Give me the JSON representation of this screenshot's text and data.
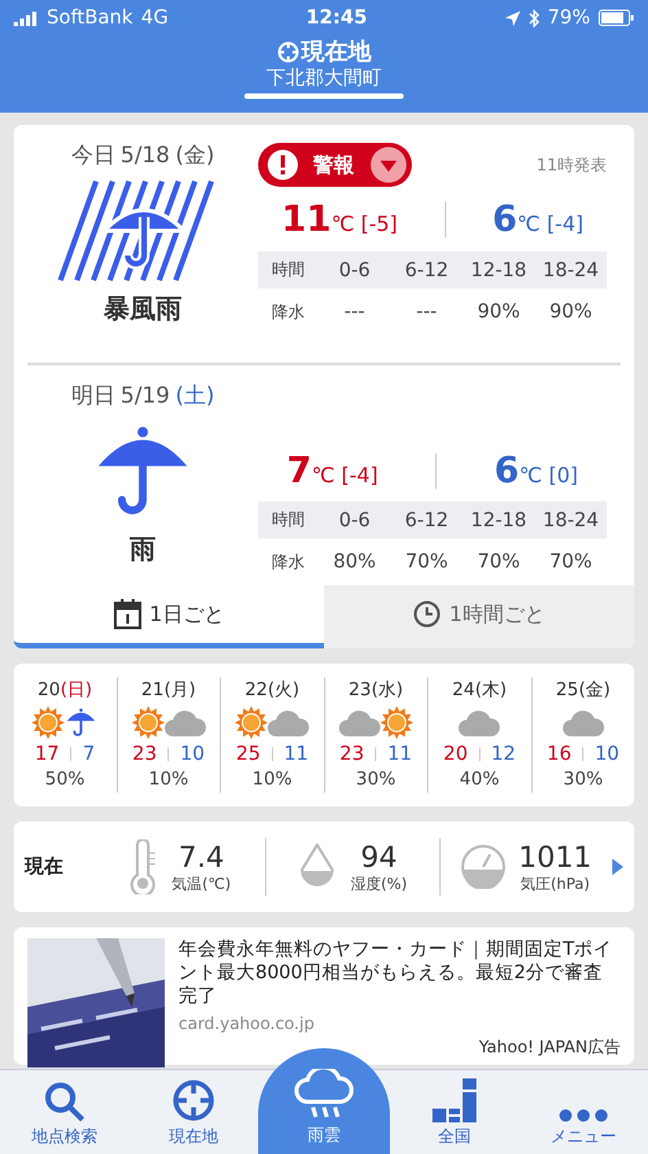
{
  "status": {
    "carrier": "SoftBank",
    "network": "4G",
    "time": "12:45",
    "battery": "79%"
  },
  "header": {
    "title": "現在地",
    "subtitle": "下北郡大間町"
  },
  "forecasts": [
    {
      "label": "今日",
      "date": "5/18",
      "weekday": "(金)",
      "saturday": false,
      "kind": "storm",
      "weather": "暴風雨",
      "warning": {
        "label": "警報"
      },
      "issued": "11時発表",
      "high": {
        "value": "11",
        "unit": "℃",
        "diff": "[-5]"
      },
      "low": {
        "value": "6",
        "unit": "℃",
        "diff": "[-4]"
      },
      "table": {
        "head": "時間",
        "columns": [
          "0-6",
          "6-12",
          "12-18",
          "18-24"
        ],
        "row": "降水",
        "values": [
          "---",
          "---",
          "90%",
          "90%"
        ]
      }
    },
    {
      "label": "明日",
      "date": "5/19",
      "weekday": "(土)",
      "saturday": true,
      "kind": "rain",
      "weather": "雨",
      "high": {
        "value": "7",
        "unit": "℃",
        "diff": "[-4]"
      },
      "low": {
        "value": "6",
        "unit": "℃",
        "diff": "[0]"
      },
      "table": {
        "head": "時間",
        "columns": [
          "0-6",
          "6-12",
          "12-18",
          "18-24"
        ],
        "row": "降水",
        "values": [
          "80%",
          "70%",
          "70%",
          "70%"
        ]
      }
    }
  ],
  "tabs": [
    {
      "label": "1日ごと",
      "kind": "calendar",
      "selected": true
    },
    {
      "label": "1時間ごと",
      "kind": "clock",
      "selected": false
    }
  ],
  "week": [
    {
      "day": "20",
      "weekday": "(日)",
      "holiday": true,
      "icons": [
        {
          "kind": "sun"
        },
        {
          "kind": "umbrella"
        }
      ],
      "high": "17",
      "low": "7",
      "pop": "50%"
    },
    {
      "day": "21",
      "weekday": "(月)",
      "holiday": false,
      "icons": [
        {
          "kind": "sun"
        },
        {
          "kind": "cloud"
        }
      ],
      "high": "23",
      "low": "10",
      "pop": "10%"
    },
    {
      "day": "22",
      "weekday": "(火)",
      "holiday": false,
      "icons": [
        {
          "kind": "sun"
        },
        {
          "kind": "cloud"
        }
      ],
      "high": "25",
      "low": "11",
      "pop": "10%"
    },
    {
      "day": "23",
      "weekday": "(水)",
      "holiday": false,
      "icons": [
        {
          "kind": "cloud"
        },
        {
          "kind": "sun"
        }
      ],
      "high": "23",
      "low": "11",
      "pop": "30%"
    },
    {
      "day": "24",
      "weekday": "(木)",
      "holiday": false,
      "icons": [
        {
          "kind": "cloud"
        }
      ],
      "high": "20",
      "low": "12",
      "pop": "40%"
    },
    {
      "day": "25",
      "weekday": "(金)",
      "holiday": false,
      "icons": [
        {
          "kind": "cloud"
        }
      ],
      "high": "16",
      "low": "10",
      "pop": "30%"
    }
  ],
  "current": {
    "label": "現在",
    "items": [
      {
        "kind": "thermometer",
        "value": "7.4",
        "label": "気温(℃)"
      },
      {
        "kind": "drop",
        "value": "94",
        "label": "湿度(%)"
      },
      {
        "kind": "gauge",
        "value": "1011",
        "label": "気圧(hPa)"
      }
    ]
  },
  "ad": {
    "text": "年会費永年無料のヤフー・カード｜期間固定Tポイント最大8000円相当がもらえる。最短2分で審査完了",
    "domain": "card.yahoo.co.jp",
    "sponsor": "Yahoo! JAPAN広告"
  },
  "nav": [
    {
      "label": "地点検索",
      "kind": "search"
    },
    {
      "label": "現在地",
      "kind": "crosshair"
    },
    {
      "label": "雨雲",
      "kind": "raincloud"
    },
    {
      "label": "全国",
      "kind": "map"
    },
    {
      "label": "メニュー",
      "kind": "dots"
    }
  ]
}
